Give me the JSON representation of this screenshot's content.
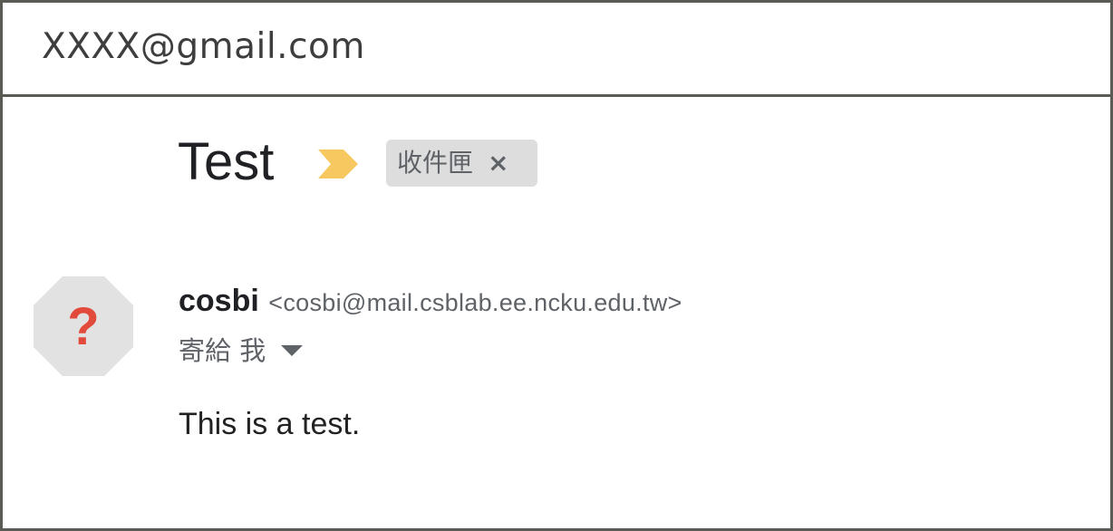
{
  "account": {
    "email": "XXXX@gmail.com"
  },
  "message": {
    "subject": "Test",
    "importance_icon": "importance-arrow-icon",
    "label": {
      "text": "收件匣",
      "remove": "×"
    },
    "sender": {
      "name": "cosbi",
      "email": "<cosbi@mail.csblab.ee.ncku.edu.tw>"
    },
    "recipient": "寄給 我",
    "body": "This is a test."
  },
  "colors": {
    "border": "#5b5b55",
    "importance": "#f6c85f",
    "chip_bg": "#dddddd",
    "avatar_bg": "#e2e2e2",
    "avatar_glyph": "#e24a3b"
  }
}
